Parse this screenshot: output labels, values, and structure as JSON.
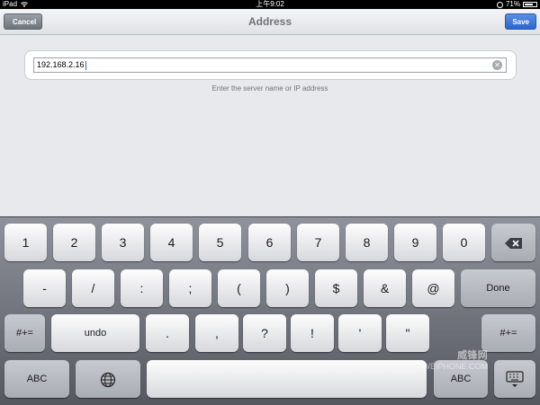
{
  "status_bar": {
    "device": "iPad",
    "time": "上午9:02",
    "battery": "71%"
  },
  "nav": {
    "title": "Address",
    "cancel_label": "Cancel",
    "save_label": "Save"
  },
  "address": {
    "value": "192.168.2.16",
    "hint": "Enter the server name or IP address"
  },
  "keyboard": {
    "row1": [
      "1",
      "2",
      "3",
      "4",
      "5",
      "6",
      "7",
      "8",
      "9",
      "0"
    ],
    "row2": [
      "-",
      "/",
      ":",
      ";",
      "(",
      ")",
      "$",
      "&",
      "@"
    ],
    "done_label": "Done",
    "row3": [
      ".",
      ",",
      "?",
      "!",
      "'",
      "\""
    ],
    "sym_label": "#+=",
    "undo_label": "undo",
    "abc_label": "ABC"
  },
  "watermark": {
    "brand": "威锋网",
    "site": "WEIPHONE.COM"
  }
}
